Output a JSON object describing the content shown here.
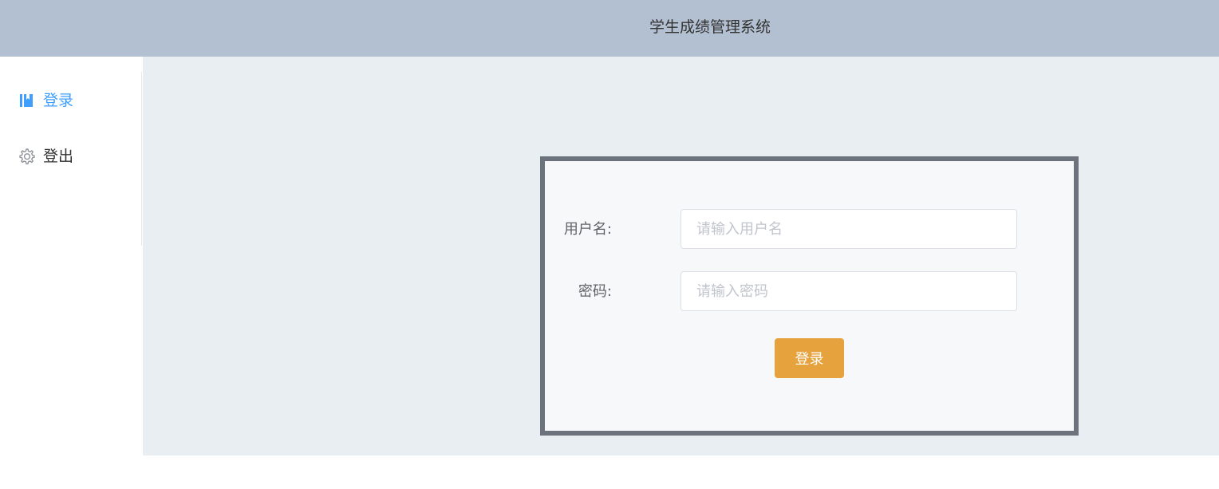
{
  "header": {
    "title": "学生成绩管理系统"
  },
  "sidebar": {
    "items": [
      {
        "label": "登录",
        "icon": "book-icon",
        "active": true
      },
      {
        "label": "登出",
        "icon": "gear-icon",
        "active": false
      }
    ]
  },
  "login_form": {
    "username_label": "用户名:",
    "username_value": "",
    "username_placeholder": "请输入用户名",
    "password_label": "密码:",
    "password_value": "",
    "password_placeholder": "请输入密码",
    "submit_label": "登录"
  },
  "colors": {
    "header_bg": "#b3c0d1",
    "main_bg": "#e9eef3",
    "active_menu": "#409eff",
    "button_bg": "#e6a23c",
    "form_border": "#6c737c"
  }
}
